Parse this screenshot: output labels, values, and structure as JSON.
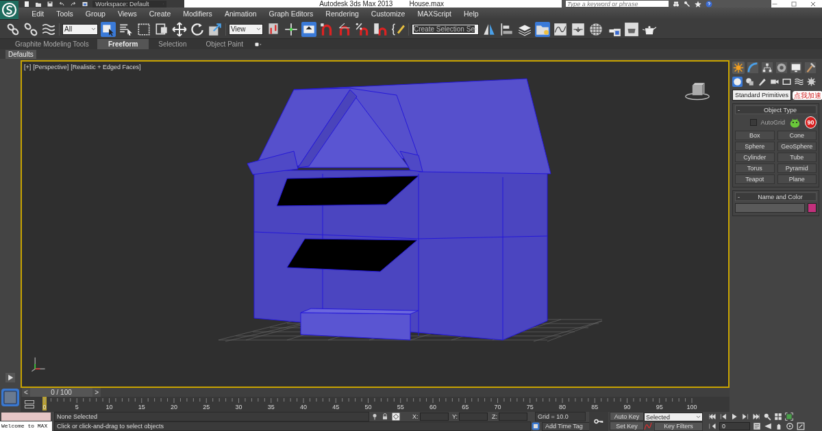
{
  "title_bar": {
    "workspace": "Workspace: Default",
    "app_title": "Autodesk 3ds Max  2013",
    "file_name": "House.max",
    "search": {
      "placeholder": "Type a keyword or phrase"
    }
  },
  "menu": [
    "Edit",
    "Tools",
    "Group",
    "Views",
    "Create",
    "Modifiers",
    "Animation",
    "Graph Editors",
    "Rendering",
    "Customize",
    "MAXScript",
    "Help"
  ],
  "toolbar": [
    {
      "kind": "link",
      "selected": false
    },
    {
      "kind": "unlink",
      "selected": false
    },
    {
      "kind": "bind",
      "selected": false
    },
    {
      "kind": "dropdown",
      "value": "All",
      "selected": false
    },
    {
      "kind": "select",
      "selected": true
    },
    {
      "kind": "select-by-name",
      "selected": false
    },
    {
      "kind": "rect-region",
      "selected": false
    },
    {
      "kind": "window",
      "selected": false
    },
    {
      "kind": "move",
      "selected": false
    },
    {
      "kind": "rotate",
      "selected": false
    },
    {
      "kind": "scale",
      "selected": false
    },
    {
      "kind": "dropdown",
      "value": "View",
      "selected": false
    },
    {
      "kind": "pivot",
      "selected": false
    },
    {
      "kind": "manipulate",
      "selected": false
    },
    {
      "kind": "keyboard",
      "selected": true
    },
    {
      "kind": "snap",
      "selected": false
    },
    {
      "kind": "angle-snap",
      "selected": false
    },
    {
      "kind": "percent-snap",
      "selected": false
    },
    {
      "kind": "spinner-snap",
      "selected": false
    },
    {
      "kind": "edit-named",
      "selected": false
    },
    {
      "kind": "dropdown",
      "value": "Create Selection Se",
      "selected": false
    },
    {
      "kind": "mirror",
      "selected": false
    },
    {
      "kind": "align",
      "selected": false
    },
    {
      "kind": "layers",
      "selected": false
    },
    {
      "kind": "scene-explorer",
      "selected": true
    },
    {
      "kind": "curve",
      "selected": false
    },
    {
      "kind": "schematic",
      "selected": false
    },
    {
      "kind": "material",
      "selected": false
    },
    {
      "kind": "render-setup",
      "selected": false
    },
    {
      "kind": "render-frame",
      "selected": false
    },
    {
      "kind": "render",
      "selected": false
    }
  ],
  "ribbon": {
    "tabs": [
      {
        "label": "Graphite Modeling Tools",
        "selected": false
      },
      {
        "label": "Freeform",
        "selected": true
      },
      {
        "label": "Selection",
        "selected": false
      },
      {
        "label": "Object Paint",
        "selected": false
      }
    ],
    "panel": "Defaults"
  },
  "viewport": {
    "labels": [
      "[+]",
      "[Perspective]",
      "[Realistic + Edged Faces]"
    ]
  },
  "command_panel": {
    "tabs": [
      {
        "kind": "create",
        "selected": true
      },
      {
        "kind": "modify",
        "selected": false
      },
      {
        "kind": "hierarchy",
        "selected": false
      },
      {
        "kind": "motion",
        "selected": false
      },
      {
        "kind": "display",
        "selected": false
      },
      {
        "kind": "utilities",
        "selected": false
      }
    ],
    "categories": [
      {
        "kind": "geometry",
        "selected": true
      },
      {
        "kind": "shapes",
        "selected": false
      },
      {
        "kind": "lights",
        "selected": false
      },
      {
        "kind": "cameras",
        "selected": false
      },
      {
        "kind": "helpers",
        "selected": false
      },
      {
        "kind": "spacewarps",
        "selected": false
      },
      {
        "kind": "systems",
        "selected": false
      }
    ],
    "type_dropdown": "Standard Primitives",
    "rollouts": [
      {
        "kind": "object_type",
        "toggle": "-",
        "title": "Object Type",
        "autogrid": {
          "label": "AutoGrid",
          "checked": false
        },
        "buttons": [
          "Box",
          "Cone",
          "Sphere",
          "GeoSphere",
          "Cylinder",
          "Tube",
          "Torus",
          "Pyramid",
          "Teapot",
          "Plane"
        ]
      },
      {
        "kind": "name_color",
        "toggle": "-",
        "title": "Name and Color",
        "color": "#c2307c"
      }
    ]
  },
  "overlay_badge": {
    "label": "点我加速",
    "count": "90"
  },
  "time_slider": {
    "prev": "<",
    "reading": "0 / 100",
    "next": ">",
    "level": 0
  },
  "track_bar": {
    "ticks": [
      "0",
      "5",
      "10",
      "15",
      "20",
      "25",
      "30",
      "35",
      "40",
      "45",
      "50",
      "55",
      "60",
      "65",
      "70",
      "75",
      "80",
      "85",
      "90",
      "95",
      "100"
    ]
  },
  "status_bar": {
    "listener": "Welcome to MAX",
    "selection": "None Selected",
    "prompt": "Click or click-and-drag to select objects",
    "x_label": "X:",
    "y_label": "Y:",
    "z_label": "Z:",
    "grid": "Grid = 10.0",
    "add_time_tag": "Add Time Tag",
    "auto_key": "Auto Key",
    "set_key": "Set Key",
    "key_mode": "Selected",
    "key_filters": "Key Filters",
    "frame": "0"
  }
}
